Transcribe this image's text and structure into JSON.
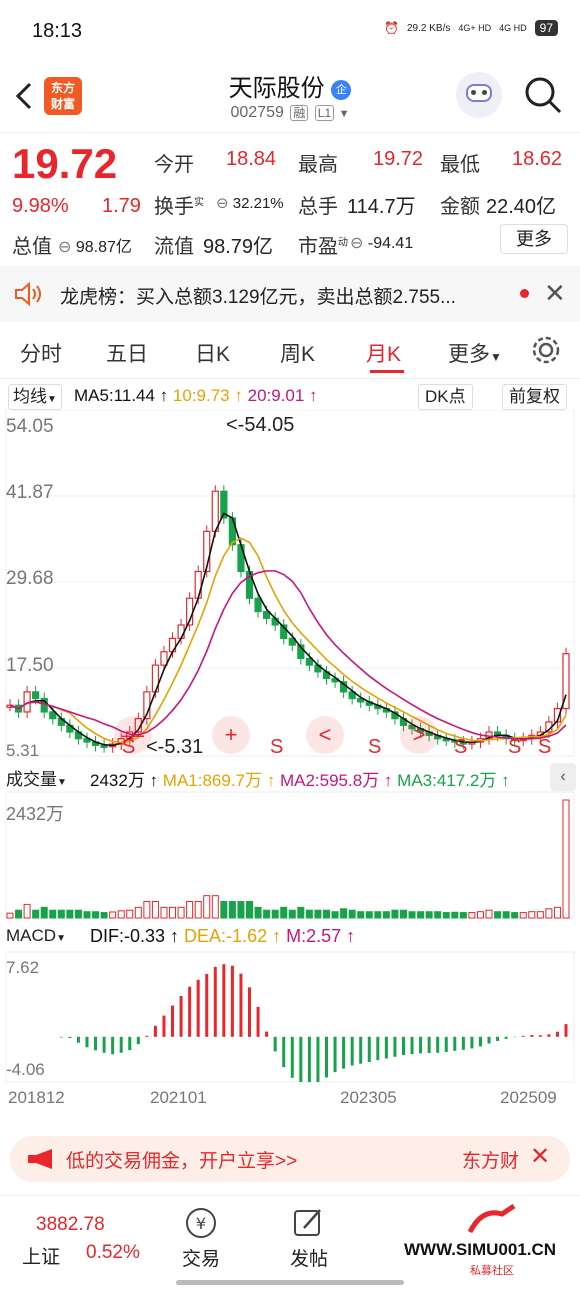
{
  "status_bar": {
    "time": "18:13",
    "net_speed": "29.2 KB/s",
    "net1": "4G+ HD",
    "net2": "4G HD",
    "battery": "97"
  },
  "header": {
    "brand": "东方财富",
    "name": "天际股份",
    "code": "002759",
    "tag1": "融",
    "tag2": "L1",
    "badge": "企"
  },
  "quote": {
    "price": "19.72",
    "pct": "9.98%",
    "change": "1.79",
    "open_label": "今开",
    "open": "18.84",
    "high_label": "最高",
    "high": "19.72",
    "low_label": "最低",
    "low": "18.62",
    "turnover_label": "换手",
    "turnover_sup": "实",
    "turnover": "32.21%",
    "volume_label": "总手",
    "volume": "114.7万",
    "amount_label": "金额",
    "amount": "22.40亿",
    "mktcap_label": "总值",
    "mktcap": "98.87亿",
    "float_label": "流值",
    "float": "98.79亿",
    "pe_label": "市盈",
    "pe_sup": "动",
    "pe": "-94.41",
    "more": "更多"
  },
  "notice": {
    "text": "龙虎榜：买入总额3.129亿元，卖出总额2.755..."
  },
  "tabs": [
    "分时",
    "五日",
    "日K",
    "周K",
    "月K",
    "更多"
  ],
  "active_tab": 4,
  "chart_header": {
    "ma_select": "均线",
    "ma5": "MA5:11.44 ↑",
    "ma10": "10:9.73 ↑",
    "ma20": "20:9.01 ↑",
    "dk": "DK点",
    "fq": "前复权"
  },
  "price_axis": [
    "54.05",
    "41.87",
    "29.68",
    "17.50",
    "5.31"
  ],
  "annotations": {
    "high": "<-54.05",
    "low": "<-5.31"
  },
  "overlay_buttons": [
    "—",
    "+",
    "<",
    ">"
  ],
  "signals": [
    "S",
    "S",
    "S",
    "S",
    "S",
    "S"
  ],
  "volume_header": {
    "select": "成交量",
    "v": "2432万 ↑",
    "ma1": "MA1:869.7万 ↑",
    "ma2": "MA2:595.8万 ↑",
    "ma3": "MA3:417.2万 ↑",
    "axis_top": "2432万"
  },
  "macd_header": {
    "select": "MACD",
    "dif": "DIF:-0.33 ↑",
    "dea": "DEA:-1.62 ↑",
    "m": "M:2.57 ↑",
    "axis_top": "7.62",
    "axis_bottom": "-4.06"
  },
  "date_axis": [
    "201812",
    "202101",
    "202305",
    "202509"
  ],
  "promo": {
    "text": "低的交易佣金，开户立享>>",
    "right": "东方财"
  },
  "bottom_nav": {
    "index_value": "3882.78",
    "index_name": "上证",
    "index_pct": "0.52%",
    "trade": "交易",
    "post": "发帖"
  },
  "watermark": {
    "text": "WWW.SIMU001.CN",
    "sub": "私募社区"
  },
  "colors": {
    "up": "#e8262b",
    "down": "#16a34a",
    "ma5": "#111111",
    "ma10": "#e8a200",
    "ma20": "#c8157e",
    "accent": "#f15a22"
  },
  "chart_data": [
    {
      "type": "candlestick",
      "title": "",
      "x_ticks": [
        "201812",
        "202101",
        "202305",
        "202509"
      ],
      "ylim": [
        5.31,
        54.05
      ],
      "y_ticks": [
        54.05,
        41.87,
        29.68,
        17.5,
        5.31
      ],
      "highest": 54.05,
      "lowest": 5.31,
      "last_close": 19.72,
      "series_ma": [
        {
          "name": "MA5",
          "value": 11.44
        },
        {
          "name": "MA10",
          "value": 9.73
        },
        {
          "name": "MA20",
          "value": 9.01
        }
      ]
    },
    {
      "type": "bar",
      "title": "",
      "ylim": [
        0,
        2432
      ],
      "unit": "万",
      "latest": 2432,
      "series_ma": [
        {
          "name": "MA1",
          "value": 869.7
        },
        {
          "name": "MA2",
          "value": 595.8
        },
        {
          "name": "MA3",
          "value": 417.2
        }
      ]
    },
    {
      "type": "bar",
      "title": "",
      "ylim": [
        -4.06,
        7.62
      ],
      "series": [
        {
          "name": "DIF",
          "value": -0.33
        },
        {
          "name": "DEA",
          "value": -1.62
        },
        {
          "name": "M",
          "value": 2.57
        }
      ]
    }
  ]
}
